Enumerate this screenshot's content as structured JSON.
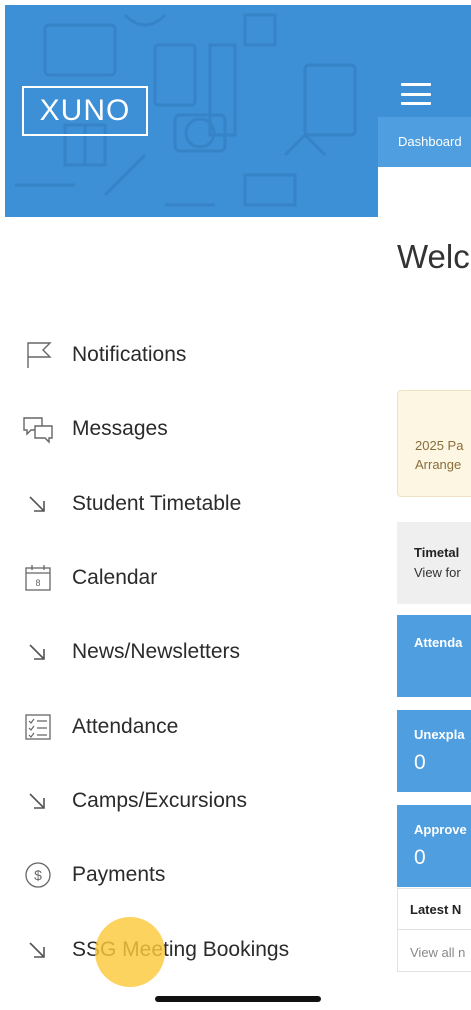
{
  "drawer": {
    "logo_text": "XUNO",
    "items": [
      {
        "label": "Notifications",
        "icon": "flag-icon"
      },
      {
        "label": "Messages",
        "icon": "chat-bubbles-icon"
      },
      {
        "label": "Student Timetable",
        "icon": "arrow-down-right-icon"
      },
      {
        "label": "Calendar",
        "icon": "calendar-icon",
        "icon_text": "8"
      },
      {
        "label": "News/Newsletters",
        "icon": "arrow-down-right-icon"
      },
      {
        "label": "Attendance",
        "icon": "checklist-icon"
      },
      {
        "label": "Camps/Excursions",
        "icon": "arrow-down-right-icon"
      },
      {
        "label": "Payments",
        "icon": "dollar-circle-icon",
        "icon_text": "$"
      },
      {
        "label": "SSG Meeting Bookings",
        "icon": "arrow-down-right-icon"
      }
    ]
  },
  "main": {
    "breadcrumb": "Dashboard",
    "welcome": "Welco",
    "notice": {
      "line1": "2025 Pa",
      "line2": "Arrange"
    },
    "tiles": {
      "timetable_title": "Timetal",
      "timetable_sub": "View for",
      "attendance_title": "Attenda",
      "unexplained_title": "Unexpla",
      "unexplained_value": "0",
      "approved_title": "Approve",
      "approved_value": "0"
    },
    "latest_title": "Latest N",
    "view_all": "View all n"
  },
  "colors": {
    "header_blue": "#3d8fd6",
    "tile_blue": "#4f9ee0",
    "notice_bg": "#fcf6e2",
    "notice_text": "#8a6d3b",
    "tap_highlight": "#fbc93c"
  }
}
